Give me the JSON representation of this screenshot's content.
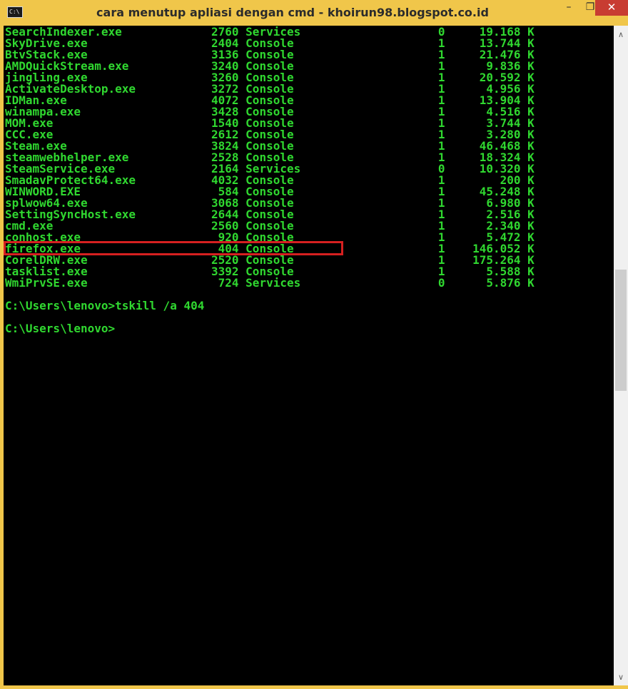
{
  "window": {
    "title": "cara menutup apliasi dengan cmd - khoirun98.blogspot.co.id",
    "icon_label": "C:\\",
    "controls": {
      "minimize": "–",
      "maximize": "❐",
      "close": "✕"
    }
  },
  "colors": {
    "frame": "#f0c64a",
    "console_bg": "#000000",
    "console_text": "#30d830",
    "highlight": "#d62020",
    "close_button": "#c83c32"
  },
  "process_table": {
    "rows": [
      {
        "image": "SearchIndexer.exe",
        "pid": "2760",
        "session": "Services",
        "num": "0",
        "mem": "19.168 K"
      },
      {
        "image": "SkyDrive.exe",
        "pid": "2404",
        "session": "Console",
        "num": "1",
        "mem": "13.744 K"
      },
      {
        "image": "BtvStack.exe",
        "pid": "3136",
        "session": "Console",
        "num": "1",
        "mem": "21.476 K"
      },
      {
        "image": "AMDQuickStream.exe",
        "pid": "3240",
        "session": "Console",
        "num": "1",
        "mem": "9.836 K"
      },
      {
        "image": "jingling.exe",
        "pid": "3260",
        "session": "Console",
        "num": "1",
        "mem": "20.592 K"
      },
      {
        "image": "ActivateDesktop.exe",
        "pid": "3272",
        "session": "Console",
        "num": "1",
        "mem": "4.956 K"
      },
      {
        "image": "IDMan.exe",
        "pid": "4072",
        "session": "Console",
        "num": "1",
        "mem": "13.904 K"
      },
      {
        "image": "winampa.exe",
        "pid": "3428",
        "session": "Console",
        "num": "1",
        "mem": "4.516 K"
      },
      {
        "image": "MOM.exe",
        "pid": "1540",
        "session": "Console",
        "num": "1",
        "mem": "3.744 K"
      },
      {
        "image": "CCC.exe",
        "pid": "2612",
        "session": "Console",
        "num": "1",
        "mem": "3.280 K"
      },
      {
        "image": "Steam.exe",
        "pid": "3824",
        "session": "Console",
        "num": "1",
        "mem": "46.468 K"
      },
      {
        "image": "steamwebhelper.exe",
        "pid": "2528",
        "session": "Console",
        "num": "1",
        "mem": "18.324 K"
      },
      {
        "image": "SteamService.exe",
        "pid": "2164",
        "session": "Services",
        "num": "0",
        "mem": "10.320 K"
      },
      {
        "image": "SmadavProtect64.exe",
        "pid": "4032",
        "session": "Console",
        "num": "1",
        "mem": "200 K"
      },
      {
        "image": "WINWORD.EXE",
        "pid": "584",
        "session": "Console",
        "num": "1",
        "mem": "45.248 K"
      },
      {
        "image": "splwow64.exe",
        "pid": "3068",
        "session": "Console",
        "num": "1",
        "mem": "6.980 K"
      },
      {
        "image": "SettingSyncHost.exe",
        "pid": "2644",
        "session": "Console",
        "num": "1",
        "mem": "2.516 K"
      },
      {
        "image": "cmd.exe",
        "pid": "2560",
        "session": "Console",
        "num": "1",
        "mem": "2.340 K"
      },
      {
        "image": "conhost.exe",
        "pid": "920",
        "session": "Console",
        "num": "1",
        "mem": "5.472 K"
      },
      {
        "image": "firefox.exe",
        "pid": "404",
        "session": "Console",
        "num": "1",
        "mem": "146.052 K"
      },
      {
        "image": "CorelDRW.exe",
        "pid": "2520",
        "session": "Console",
        "num": "1",
        "mem": "175.264 K"
      },
      {
        "image": "tasklist.exe",
        "pid": "3392",
        "session": "Console",
        "num": "1",
        "mem": "5.588 K"
      },
      {
        "image": "WmiPrvSE.exe",
        "pid": "724",
        "session": "Services",
        "num": "0",
        "mem": "5.876 K"
      }
    ]
  },
  "commands": {
    "command_line": "C:\\Users\\lenovo>tskill /a 404",
    "prompt_line": "C:\\Users\\lenovo>"
  },
  "scrollbar": {
    "up_arrow": "∧",
    "down_arrow": "∨"
  }
}
